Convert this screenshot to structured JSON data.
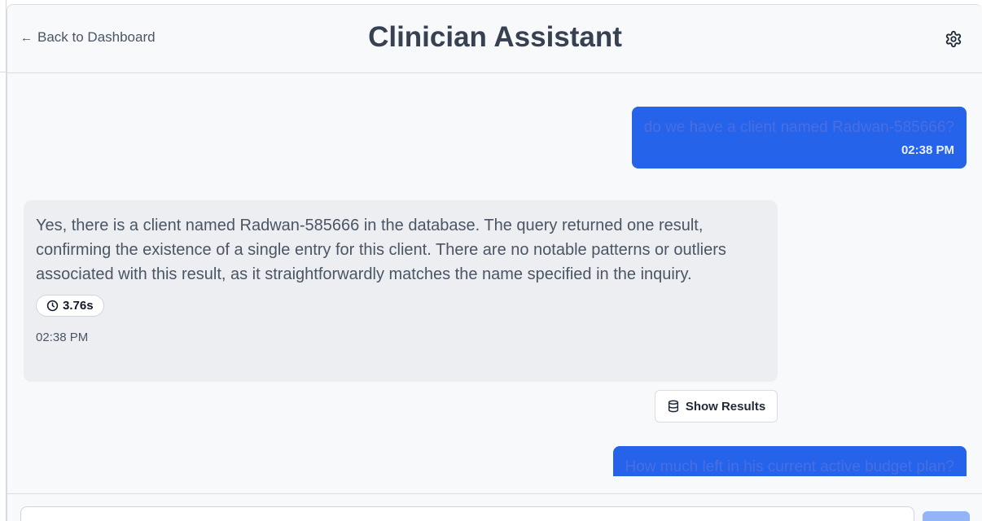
{
  "header": {
    "back_label": "Back to Dashboard",
    "back_arrow": "←",
    "title": "Clinician Assistant",
    "settings_icon": "gear-icon"
  },
  "messages": [
    {
      "role": "user",
      "text": "do we have a client named Radwan-585666?",
      "time": "02:38 PM"
    },
    {
      "role": "assistant",
      "text": "Yes, there is a client named Radwan-585666 in the database. The query returned one result, confirming the existence of a single entry for this client. There are no notable patterns or outliers associated with this result, as it straightforwardly matches the name specified in the inquiry.",
      "duration": "3.76s",
      "time": "02:38 PM",
      "action_label": "Show Results"
    },
    {
      "role": "user",
      "text": "How much left in his current active budget plan?"
    }
  ],
  "composer": {
    "placeholder": "",
    "send_icon": "send-icon"
  },
  "colors": {
    "user_bubble": "#2563eb",
    "assistant_bubble": "#eceef2",
    "send_button": "#93b4f7"
  }
}
